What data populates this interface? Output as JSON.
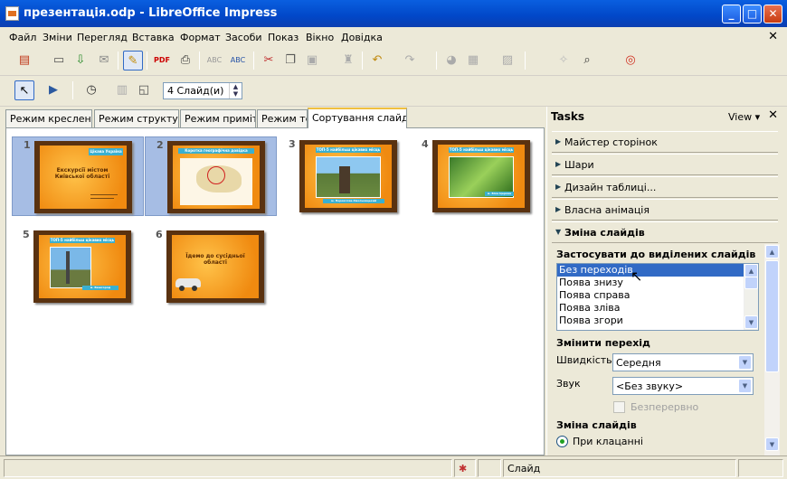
{
  "window": {
    "title": "презентація.odp - LibreOffice Impress"
  },
  "menu": [
    "Файл",
    "Зміни",
    "Перегляд",
    "Вставка",
    "Формат",
    "Засоби",
    "Показ",
    "Вікно",
    "Довідка"
  ],
  "toolbar2": {
    "slide_count_value": "4 Слайд(и)"
  },
  "tabs": [
    "Режим креслення",
    "Режим структури",
    "Режим приміток",
    "Режим тез",
    "Сортування слайду"
  ],
  "active_tab": "Сортування слайду",
  "slides": [
    {
      "number": "1",
      "banner": "Цікава Україна",
      "title": "Екскурсії містом Київської області",
      "selected": true
    },
    {
      "number": "2",
      "banner": "Коротка географічна довідка",
      "selected": true
    },
    {
      "number": "3",
      "banner": "ТОП-5 найбільш цікавих місць",
      "caption": "м. Переяслав-Хмельницький",
      "selected": false
    },
    {
      "number": "4",
      "banner": "ТОП-5 найбільш цікавих місць",
      "caption": "м. Біла Церква",
      "selected": false
    },
    {
      "number": "5",
      "banner": "ТОП-5 найбільш цікавих місць",
      "caption": "м. Вишгород",
      "selected": false
    },
    {
      "number": "6",
      "title": "Їдемо до сусідньої області",
      "selected": false
    }
  ],
  "tasks": {
    "header": "Tasks",
    "view_label": "View",
    "panels": [
      "Майстер сторінок",
      "Шари",
      "Дизайн таблиці...",
      "Власна анімація",
      "Зміна слайдів"
    ],
    "apply_heading": "Застосувати до виділених слайдів",
    "transitions": [
      "Без переходів",
      "Поява знизу",
      "Поява справа",
      "Поява зліва",
      "Поява згори"
    ],
    "selected_transition": "Без переходів",
    "modify_heading": "Змінити перехід",
    "speed_label": "Швидкість",
    "speed_value": "Середня",
    "sound_label": "Звук",
    "sound_value": "<Без звуку>",
    "loop_label": "Безперервно",
    "advance_heading": "Зміна слайдів",
    "advance_option": "При клацанні"
  },
  "status": {
    "mode": "Слайд"
  }
}
